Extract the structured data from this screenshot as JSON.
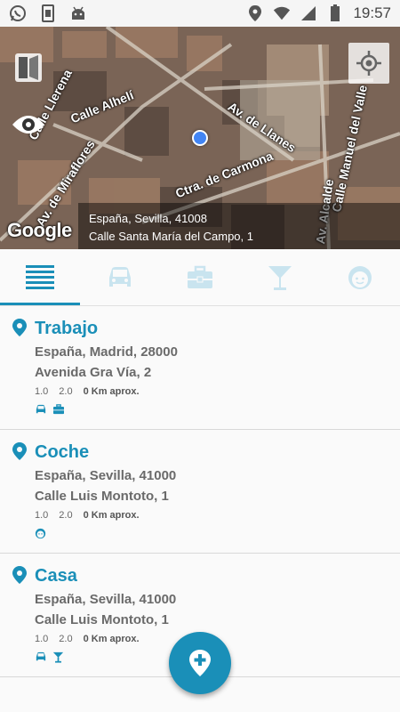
{
  "status_bar": {
    "left_icons": [
      "whatsapp-icon",
      "sim-card-icon",
      "android-icon"
    ],
    "right_icons": [
      "location-icon",
      "wifi-icon",
      "signal-icon",
      "battery-icon"
    ],
    "time": "19:57"
  },
  "map": {
    "street_labels": [
      "Calle Llerena",
      "Calle Alhelí",
      "Av. de Llanes",
      "Calle Manuel del Valle",
      "Av. de Miraflores",
      "Ctra. de Carmona",
      "Av. Alcalde"
    ],
    "logo": "Google",
    "address_line1": "España, Sevilla, 41008",
    "address_line2": "Calle Santa María del Campo, 1"
  },
  "tabs": [
    {
      "icon": "list-icon",
      "active": true
    },
    {
      "icon": "car-icon",
      "active": false
    },
    {
      "icon": "briefcase-icon",
      "active": false
    },
    {
      "icon": "cocktail-icon",
      "active": false
    },
    {
      "icon": "baby-face-icon",
      "active": false
    }
  ],
  "places": [
    {
      "title": "Trabajo",
      "region": "España, Madrid, 28000",
      "street": "Avenida Gra Vía, 2",
      "v1": "1.0",
      "v2": "2.0",
      "distance": "0 Km aprox.",
      "categories": [
        "car-icon",
        "briefcase-icon"
      ]
    },
    {
      "title": "Coche",
      "region": "España, Sevilla, 41000",
      "street": "Calle Luis Montoto, 1",
      "v1": "1.0",
      "v2": "2.0",
      "distance": "0 Km aprox.",
      "categories": [
        "baby-face-icon"
      ]
    },
    {
      "title": "Casa",
      "region": "España, Sevilla, 41000",
      "street": "Calle Luis Montoto, 1",
      "v1": "1.0",
      "v2": "2.0",
      "distance": "0 Km aprox.",
      "categories": [
        "car-icon",
        "cocktail-icon"
      ]
    }
  ],
  "fab": {
    "icon": "add-location-icon"
  },
  "colors": {
    "accent": "#1a8fb8",
    "inactive_icon": "#c9e4ef",
    "text_secondary": "#6a6a6a"
  }
}
